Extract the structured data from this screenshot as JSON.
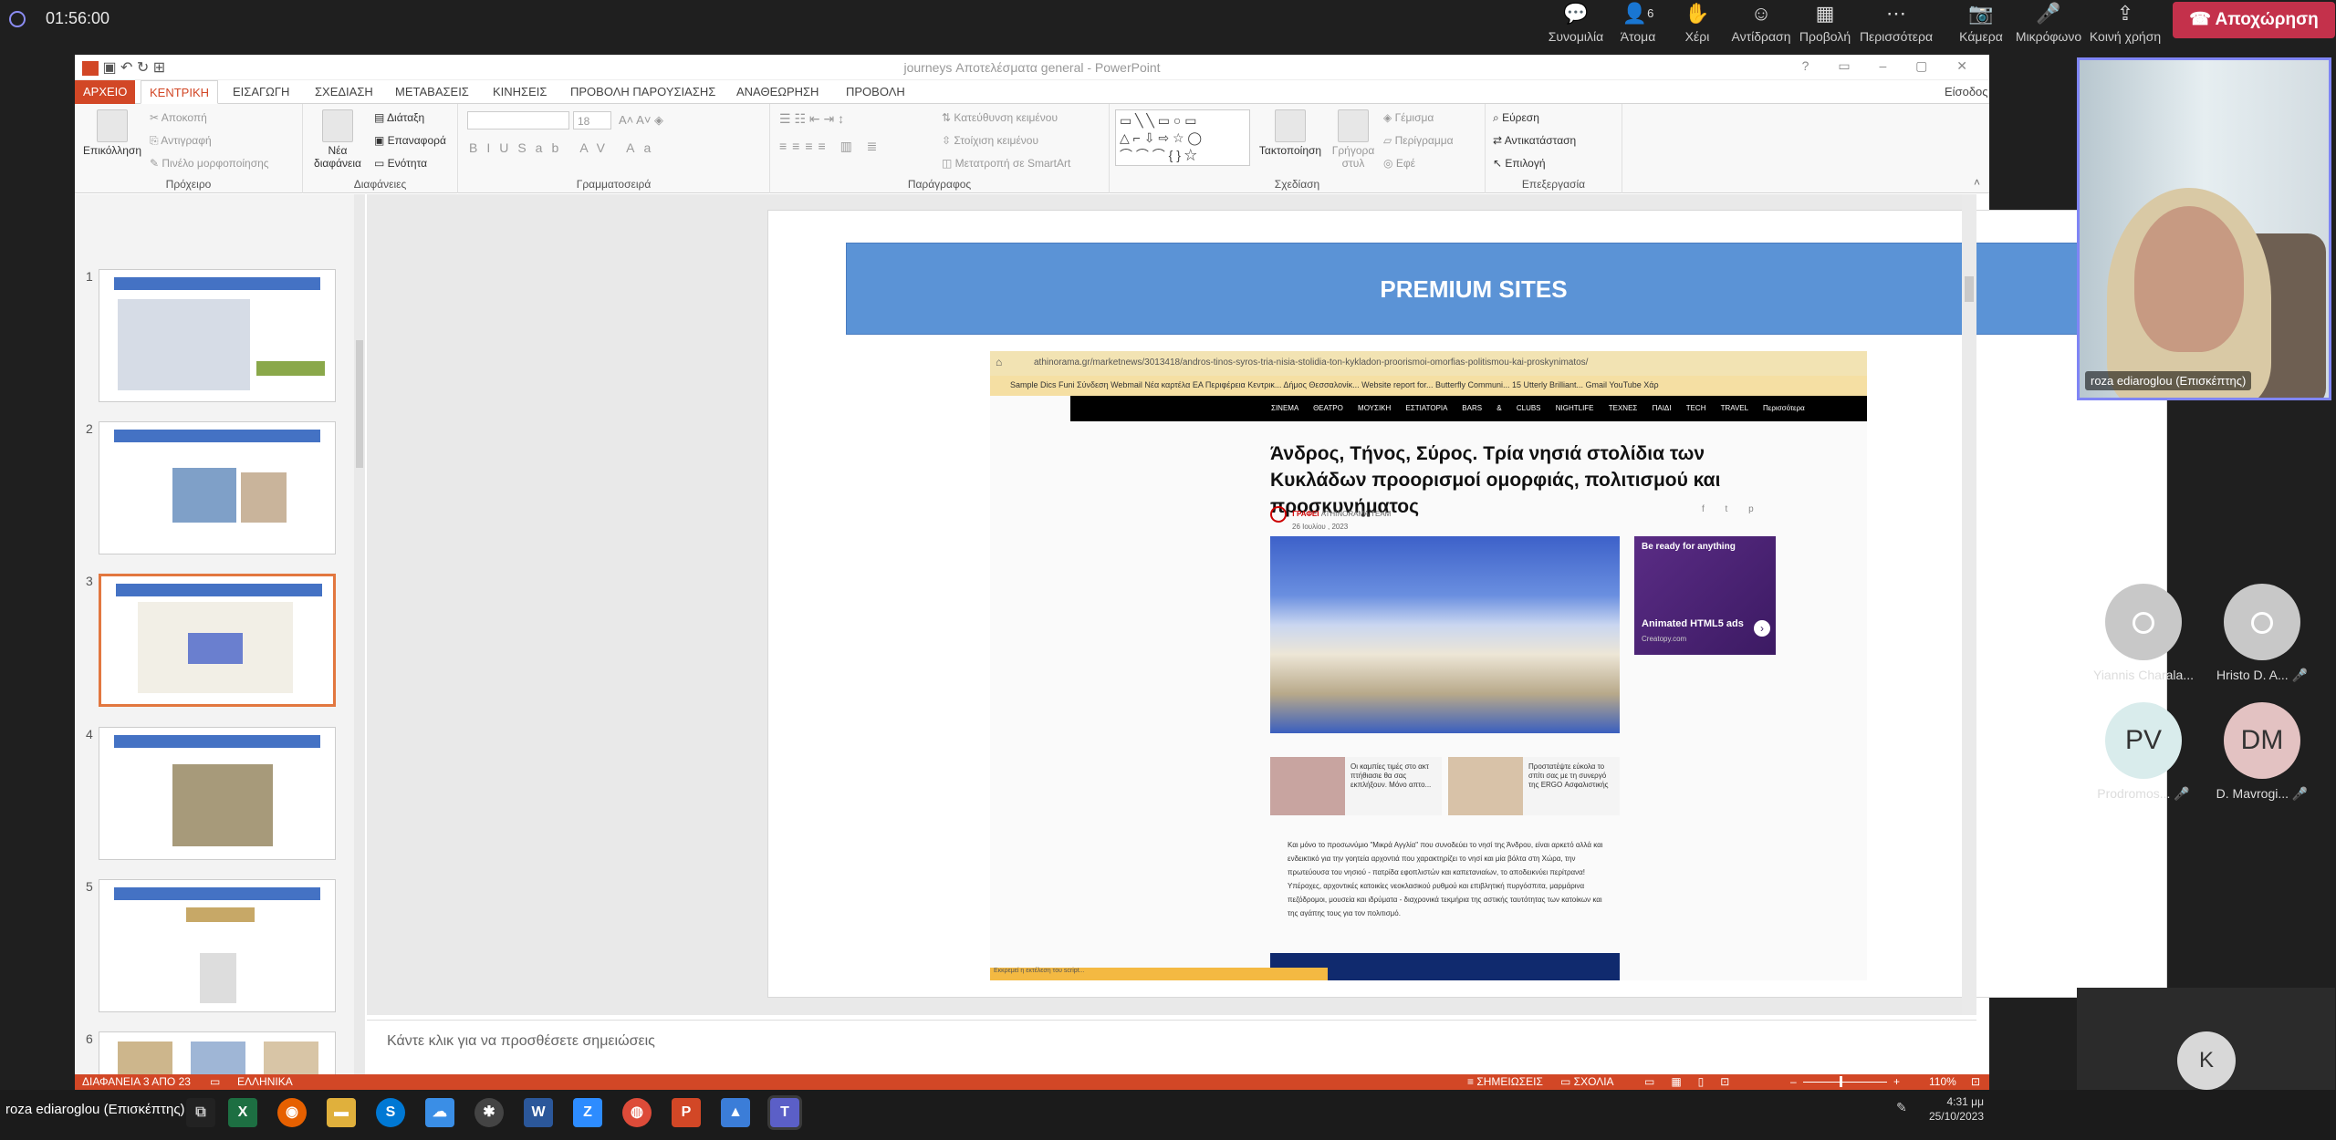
{
  "teams": {
    "timer": "01:56:00",
    "buttons": [
      {
        "label": "Συνομιλία",
        "icon": "chat-icon",
        "glyph": "💬"
      },
      {
        "label": "Άτομα",
        "icon": "people-icon",
        "glyph": "👤",
        "count": "6"
      },
      {
        "label": "Χέρι",
        "icon": "raise-hand-icon",
        "glyph": "✋"
      },
      {
        "label": "Αντίδραση",
        "icon": "reaction-icon",
        "glyph": "☺"
      },
      {
        "label": "Προβολή",
        "icon": "view-icon",
        "glyph": "▦"
      },
      {
        "label": "Περισσότερα",
        "icon": "more-icon",
        "glyph": "⋯"
      },
      {
        "label": "Κάμερα",
        "icon": "camera-off-icon",
        "glyph": "📷"
      },
      {
        "label": "Μικρόφωνο",
        "icon": "mic-off-icon",
        "glyph": "🎤"
      },
      {
        "label": "Κοινή χρήση",
        "icon": "share-icon",
        "glyph": "⇪"
      }
    ],
    "leave_label": "Αποχώρηση",
    "main_video_name": "roza ediaroglou (Επισκέπτης)",
    "participants": [
      {
        "name": "Yiannis Charala...",
        "initials": "",
        "muted": false
      },
      {
        "name": "Hristo D. A...",
        "initials": "",
        "muted": true
      },
      {
        "name": "Prodromos...",
        "initials": "PV",
        "muted": true
      },
      {
        "name": "D. Mavrogi...",
        "initials": "DM",
        "muted": true
      }
    ],
    "self_initial": "K"
  },
  "ppt": {
    "window_title": "journeys Αποτελέσματα general - PowerPoint",
    "tabs": [
      "ΑΡΧΕΙΟ",
      "ΚΕΝΤΡΙΚΗ",
      "ΕΙΣΑΓΩΓΗ",
      "ΣΧΕΔΙΑΣΗ",
      "ΜΕΤΑΒΑΣΕΙΣ",
      "ΚΙΝΗΣΕΙΣ",
      "ΠΡΟΒΟΛΗ ΠΑΡΟΥΣΙΑΣΗΣ",
      "ΑΝΑΘΕΩΡΗΣΗ",
      "ΠΡΟΒΟΛΗ"
    ],
    "signin": "Είσοδος",
    "ribbon": {
      "clipboard": {
        "paste": "Επικόλληση",
        "cut": "Αποκοπή",
        "copy": "Αντιγραφή",
        "painter": "Πινέλο μορφοποίησης",
        "label": "Πρόχειρο"
      },
      "slides": {
        "new": "Νέα διαφάνεια",
        "layout": "Διάταξη",
        "reset": "Επαναφορά",
        "section": "Ενότητα",
        "label": "Διαφάνειες"
      },
      "font": {
        "size": "18",
        "label": "Γραμματοσειρά"
      },
      "paragraph": {
        "direction": "Κατεύθυνση κειμένου",
        "align": "Στοίχιση κειμένου",
        "smartart": "Μετατροπή σε SmartArt",
        "label": "Παράγραφος"
      },
      "drawing": {
        "arrange": "Τακτοποίηση",
        "quick": "Γρήγορα στυλ",
        "fill": "Γέμισμα",
        "outline": "Περίγραμμα",
        "effects": "Εφέ",
        "label": "Σχεδίαση"
      },
      "editing": {
        "find": "Εύρεση",
        "replace": "Αντικατάσταση",
        "select": "Επιλογή",
        "label": "Επεξεργασία"
      }
    },
    "thumbnails": [
      "1",
      "2",
      "3",
      "4",
      "5",
      "6"
    ],
    "selected_slide": 3,
    "slide": {
      "banner": "PREMIUM SITES",
      "screenshot": {
        "url": "athinorama.gr/marketnews/3013418/andros-tinos-syros-tria-nisia-stolidia-ton-kykladon-proorismoi-omorfias-politismou-kai-proskynimatos/",
        "bookmarks": "Sample Dics Funi   Σύνδεση Webmail   Νέα καρτέλα   ΕΑ   Περιφέρεια Κεντρικ...   Δήμος Θεσσαλονίκ...   Website report for...   Butterfly Communi...   15 Utterly Brilliant...   Gmail   YouTube   Χάρ",
        "nav": "ΣΙΝΕΜΑ ΘΕΑΤΡΟ ΜΟΥΣΙΚΗ ΕΣΤΙΑΤΟΡΙΑ BARS & CLUBS NIGHTLIFE ΤΕΧΝΕΣ ΠΑΙΔΙ TECH TRAVEL Περισσότερα",
        "title": "Άνδρος, Τήνος, Σύρος. Τρία νησιά στολίδια των Κυκλάδων προορισμοί ομορφιάς, πολιτισμού και προσκυνήματος",
        "author_label": "ΓΡΑΦΕΙ",
        "author": "ATHINORAMA TEAM",
        "date": "26 Ιουλίου , 2023",
        "ad_line1": "Be ready for anything",
        "ad_title": "Animated HTML5 ads",
        "ad_site": "Creatopy.com",
        "related1": "Οι καμπίες τιμές στο ακτ πτήθιασιε θα σας εκπλήξουν. Μόνο απτο...",
        "related2": "Προστατέψτε εύκολα το σπίτι σας με τη συνεργό της ERGO Ασφαλιστικής",
        "body": "Και μόνο το προσωνύμιο \"Μικρά Αγγλία\" που συνοδεύει το νησί της Άνδρου, είναι αρκετό αλλά και ενδεικτικό για την γοητεία αρχοντιά που χαρακτηρίζει το νησί και μία βόλτα στη Χώρα, την πρωτεύουσα του νησιού - πατρίδα εφοπλιστών και καπετανιαίων, το αποδεικνύει περίτρανα! Υπέροχες, αρχοντικές κατοικίες νεοκλασικού ρυθμού και επιβλητική πυργόσπιτα, μαρμάρινα πεζόδρομοι, μουσεία και ιδρύματα - διαχρονικά τεκμήρια της αστικής ταυτότητας των κατοίκων και της αγάπης τους για τον πολιτισμό.",
        "status": "Εκκρεμεί η εκτέλεση του script..."
      }
    },
    "notes_placeholder": "Κάντε κλικ για να προσθέσετε σημειώσεις",
    "statusbar": {
      "slide_info": "ΔΙΑΦΑΝΕΙΑ 3 ΑΠΟ 23",
      "language": "ΕΛΛΗΝΙΚΑ",
      "notes": "ΣΗΜΕΙΩΣΕΙΣ",
      "comments": "ΣΧΟΛΙΑ",
      "zoom": "110%"
    }
  },
  "taskbar": {
    "presenter": "roza ediaroglou (Επισκέπτης)",
    "time": "4:31 μμ",
    "date": "25/10/2023"
  },
  "colors": {
    "ppt_accent": "#d24726",
    "banner": "#5b93d6",
    "teams_leave": "#c4314b",
    "teams_highlight": "#7f85f5"
  }
}
